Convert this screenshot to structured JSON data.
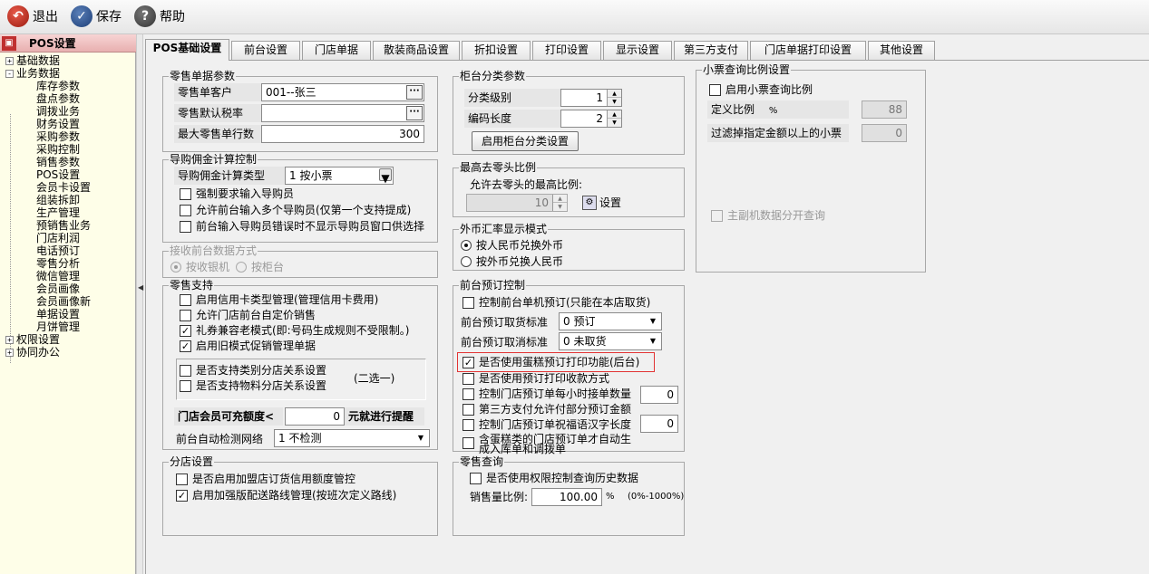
{
  "toolbar": {
    "exit": "退出",
    "save": "保存",
    "help": "帮助"
  },
  "left_panel": {
    "header": "POS设置",
    "tree": [
      {
        "label": "基础数据",
        "expander": "+"
      },
      {
        "label": "业务数据",
        "expander": "-"
      },
      {
        "label": "库存参数"
      },
      {
        "label": "盘点参数"
      },
      {
        "label": "调拨业务"
      },
      {
        "label": "财务设置"
      },
      {
        "label": "采购参数"
      },
      {
        "label": "采购控制"
      },
      {
        "label": "销售参数"
      },
      {
        "label": "POS设置"
      },
      {
        "label": "会员卡设置"
      },
      {
        "label": "组装拆卸"
      },
      {
        "label": "生产管理"
      },
      {
        "label": "预销售业务"
      },
      {
        "label": "门店利润"
      },
      {
        "label": "电话预订"
      },
      {
        "label": "零售分析"
      },
      {
        "label": "微信管理"
      },
      {
        "label": "会员画像"
      },
      {
        "label": "会员画像新"
      },
      {
        "label": "单据设置"
      },
      {
        "label": "月饼管理"
      },
      {
        "label": "权限设置",
        "expander": "+"
      },
      {
        "label": "协同办公",
        "expander": "+"
      }
    ]
  },
  "tabs": [
    {
      "label": "POS基础设置",
      "active": true
    },
    {
      "label": "前台设置"
    },
    {
      "label": "门店单据"
    },
    {
      "label": "散装商品设置"
    },
    {
      "label": "折扣设置"
    },
    {
      "label": "打印设置"
    },
    {
      "label": "显示设置"
    },
    {
      "label": "第三方支付"
    },
    {
      "label": "门店单据打印设置"
    },
    {
      "label": "其他设置"
    }
  ],
  "retail_doc": {
    "title": "零售单据参数",
    "customer_label": "零售单客户",
    "customer_value": "001--张三",
    "tax_label": "零售默认税率",
    "tax_value": "",
    "max_rows_label": "最大零售单行数",
    "max_rows_value": "300"
  },
  "guide": {
    "title": "导购佣金计算控制",
    "type_label": "导购佣金计算类型",
    "type_value": "1 按小票",
    "opt1": "强制要求输入导购员",
    "opt2": "允许前台输入多个导购员(仅第一个支持提成)",
    "opt3": "前台输入导购员错误时不显示导购员窗口供选择"
  },
  "receive": {
    "title": "接收前台数据方式",
    "opt1": "按收银机",
    "opt2": "按柜台"
  },
  "retail_support": {
    "title": "零售支持",
    "opt1": "启用信用卡类型管理(管理信用卡费用)",
    "opt2": "允许门店前台自定价销售",
    "opt3": "礼券兼容老模式(即:号码生成规则不受限制。)",
    "opt4": "启用旧模式促销管理单据",
    "sub1": "是否支持类别分店关系设置",
    "sub2": "是否支持物料分店关系设置",
    "choose_one": "(二选一)",
    "member_label": "门店会员可充额度<",
    "member_value": "0",
    "member_suffix": "元就进行提醒",
    "network_label": "前台自动检测网络",
    "network_value": "1 不检测"
  },
  "branch": {
    "title": "分店设置",
    "opt1": "是否启用加盟店订货信用额度管控",
    "opt2": "启用加强版配送路线管理(按班次定义路线)"
  },
  "counter": {
    "title": "柜台分类参数",
    "level_label": "分类级别",
    "level_value": "1",
    "code_label": "编码长度",
    "code_value": "2",
    "enable_btn": "启用柜台分类设置"
  },
  "rounding": {
    "title": "最高去零头比例",
    "label": "允许去零头的最高比例:",
    "value": "10",
    "set": "设置"
  },
  "fx": {
    "title": "外币汇率显示模式",
    "opt1": "按人民币兑换外币",
    "opt2": "按外币兑换人民币"
  },
  "preorder": {
    "title": "前台预订控制",
    "opt1": "控制前台单机预订(只能在本店取货)",
    "pickup_label": "前台预订取货标准",
    "pickup_value": "0 预订",
    "cancel_label": "前台预订取消标准",
    "cancel_value": "0 未取货",
    "opt2": "是否使用蛋糕预订打印功能(后台)",
    "opt3": "是否使用预订打印收款方式",
    "opt4": "控制门店预订单每小时接单数量",
    "opt4_value": "0",
    "opt5": "第三方支付允许付部分预订金额",
    "opt6": "控制门店预订单祝福语汉字长度",
    "opt6_value": "0",
    "opt7_line1": "含蛋糕类的门店预订单才自动生",
    "opt7_line2": "成入库单和调拨单"
  },
  "retail_query": {
    "title": "零售查询",
    "opt1": "是否使用权限控制查询历史数据",
    "ratio_label": "销售量比例:",
    "ratio_value": "100.00",
    "ratio_unit": "%",
    "ratio_range": "(0%-1000%)"
  },
  "receipt_query": {
    "title": "小票查询比例设置",
    "opt1": "启用小票查询比例",
    "define_label": "定义比例",
    "define_unit": "%",
    "define_value": "88",
    "filter_label": "过滤掉指定金额以上的小票",
    "filter_value": "0",
    "opt2": "主副机数据分开查询"
  },
  "colors": {
    "highlight_border": "#e23434",
    "tree_panel_bg": "#fefee8",
    "header_bg": "#e8b0b0"
  }
}
